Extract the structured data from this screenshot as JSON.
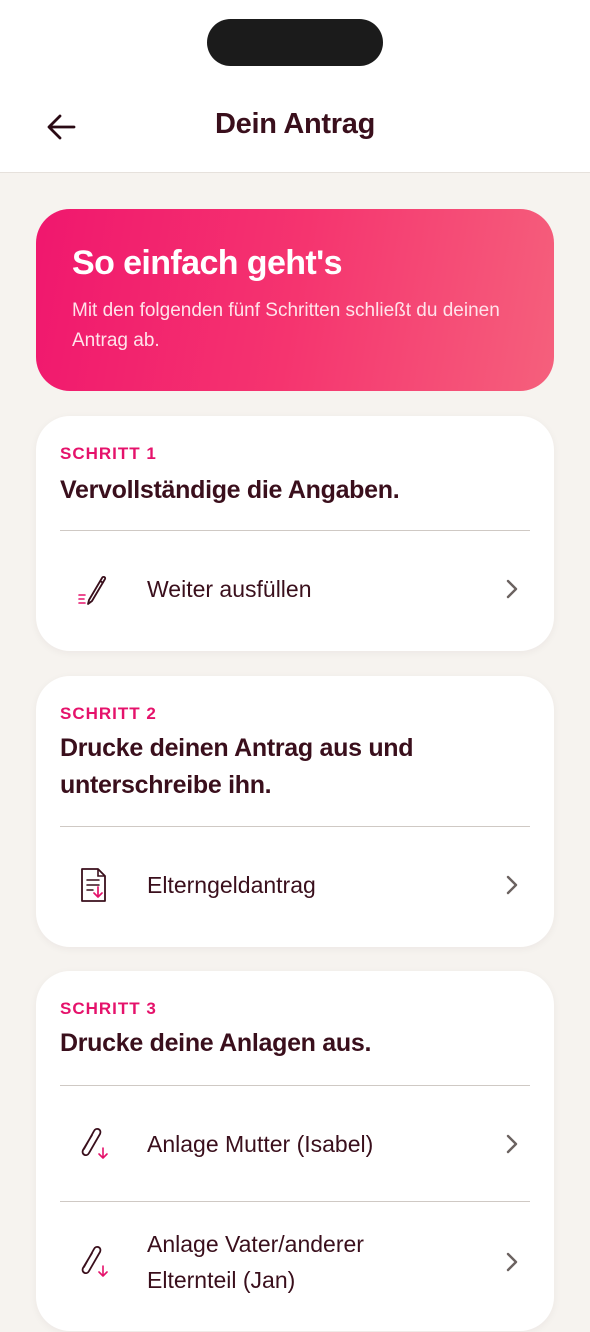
{
  "header": {
    "title": "Dein Antrag"
  },
  "hero": {
    "title": "So einfach geht's",
    "subtitle": "Mit den folgenden fünf Schritten schließt du deinen Antrag ab."
  },
  "steps": [
    {
      "label": "SCHRITT 1",
      "title": "Vervollständige die Angaben.",
      "items": [
        {
          "label": "Weiter ausfüllen",
          "icon": "pencil-icon"
        }
      ]
    },
    {
      "label": "SCHRITT 2",
      "title": "Drucke deinen Antrag aus und unterschreibe ihn.",
      "items": [
        {
          "label": "Elterngeldantrag",
          "icon": "document-download-icon"
        }
      ]
    },
    {
      "label": "SCHRITT 3",
      "title": "Drucke deine Anlagen aus.",
      "items": [
        {
          "label": "Anlage Mutter (Isabel)",
          "icon": "paperclip-download-icon"
        },
        {
          "label": "Anlage Vater/anderer Elternteil (Jan)",
          "icon": "paperclip-download-icon"
        }
      ]
    }
  ],
  "colors": {
    "accent": "#e5126b",
    "text": "#3a0f1c",
    "background": "#f6f3ef"
  }
}
